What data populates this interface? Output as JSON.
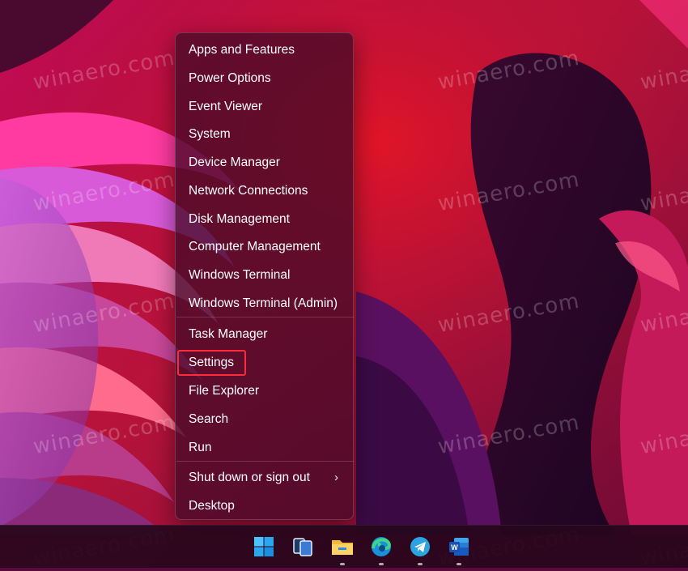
{
  "context_menu": {
    "items": [
      {
        "label": "Apps and Features"
      },
      {
        "label": "Power Options"
      },
      {
        "label": "Event Viewer"
      },
      {
        "label": "System"
      },
      {
        "label": "Device Manager"
      },
      {
        "label": "Network Connections"
      },
      {
        "label": "Disk Management"
      },
      {
        "label": "Computer Management"
      },
      {
        "label": "Windows Terminal"
      },
      {
        "label": "Windows Terminal (Admin)"
      },
      {
        "label": "Task Manager"
      },
      {
        "label": "Settings",
        "highlighted": true
      },
      {
        "label": "File Explorer"
      },
      {
        "label": "Search"
      },
      {
        "label": "Run"
      },
      {
        "label": "Shut down or sign out",
        "submenu": true
      },
      {
        "label": "Desktop"
      }
    ]
  },
  "watermark": "winaero.com",
  "taskbar": {
    "icons": [
      "windows-start-icon",
      "task-view-icon",
      "file-explorer-icon",
      "edge-browser-icon",
      "telegram-icon",
      "word-icon"
    ]
  },
  "colors": {
    "highlight_border": "#ff2b3a",
    "menu_background": "#460a28"
  }
}
